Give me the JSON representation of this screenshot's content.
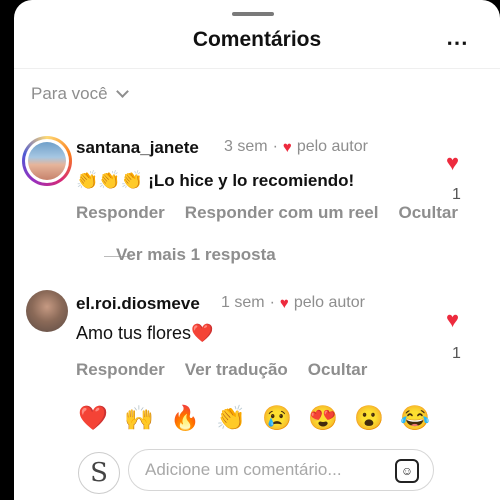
{
  "header": {
    "title": "Comentários",
    "more_icon": "⋯"
  },
  "filter": {
    "label": "Para você"
  },
  "comments": [
    {
      "username": "santana_janete",
      "time": "3 sem",
      "liked_by_author": "pelo autor",
      "text_emoji": "👏👏👏",
      "text": "¡Lo hice y lo recomiendo!",
      "actions": [
        "Responder",
        "Responder com um reel",
        "Ocultar"
      ],
      "likes": "1"
    },
    {
      "username": "el.roi.diosmeve",
      "time": "1 sem",
      "liked_by_author": "pelo autor",
      "text": "Amo tus flores❤️",
      "actions": [
        "Responder",
        "Ver tradução",
        "Ocultar"
      ],
      "likes": "1"
    }
  ],
  "replies": {
    "label": "Ver mais 1 resposta"
  },
  "quick_reactions": [
    "❤️",
    "🙌",
    "🔥",
    "👏",
    "😢",
    "😍",
    "😮",
    "😂"
  ],
  "composer": {
    "placeholder": "Adicione um comentário...",
    "avatar_letter": "S"
  },
  "colors": {
    "heart": "#ed2b3e",
    "muted": "#8e8e8e"
  }
}
